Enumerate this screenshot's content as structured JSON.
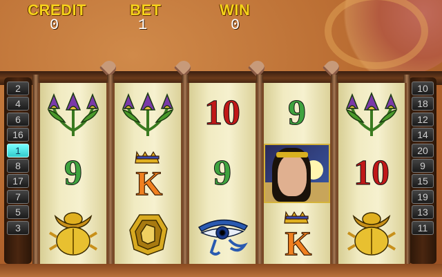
{
  "header": {
    "credit_label": "CREDIT",
    "credit_value": "0",
    "bet_label": "BET",
    "bet_value": "1",
    "win_label": "WIN",
    "win_value": "0"
  },
  "lines_left": [
    "2",
    "4",
    "6",
    "16",
    "1",
    "8",
    "17",
    "7",
    "5",
    "3"
  ],
  "lines_right": [
    "10",
    "18",
    "12",
    "14",
    "20",
    "9",
    "15",
    "19",
    "13",
    "11"
  ],
  "active_line": "1",
  "reels": [
    [
      {
        "type": "symbol",
        "icon": "lotus-flower-icon"
      },
      {
        "type": "number",
        "text": "9",
        "color": "green"
      },
      {
        "type": "symbol",
        "icon": "scarab-beetle-icon"
      }
    ],
    [
      {
        "type": "symbol",
        "icon": "lotus-flower-icon"
      },
      {
        "type": "symbol",
        "icon": "king-k-icon",
        "text": "K"
      },
      {
        "type": "symbol",
        "icon": "gold-ring-icon"
      }
    ],
    [
      {
        "type": "number",
        "text": "10",
        "color": "red"
      },
      {
        "type": "number",
        "text": "9",
        "color": "green"
      },
      {
        "type": "symbol",
        "icon": "eye-of-horus-icon"
      }
    ],
    [
      {
        "type": "number",
        "text": "9",
        "color": "green"
      },
      {
        "type": "symbol",
        "icon": "cleopatra-icon"
      },
      {
        "type": "symbol",
        "icon": "king-k-icon",
        "text": "K"
      }
    ],
    [
      {
        "type": "symbol",
        "icon": "lotus-flower-icon"
      },
      {
        "type": "number",
        "text": "10",
        "color": "red"
      },
      {
        "type": "symbol",
        "icon": "scarab-beetle-icon"
      }
    ]
  ],
  "colors": {
    "label_yellow": "#f5d21a",
    "active_line": "#3cc",
    "number_green": "#3fa33f",
    "number_red": "#c01818"
  }
}
